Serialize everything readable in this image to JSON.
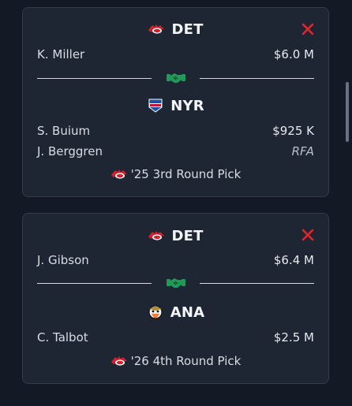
{
  "trades": [
    {
      "teams": [
        {
          "abbr": "DET",
          "players": [
            {
              "name": "K. Miller",
              "value": "$6.0 M"
            }
          ]
        },
        {
          "abbr": "NYR",
          "players": [
            {
              "name": "S. Buium",
              "value": "$925 K"
            },
            {
              "name": "J. Berggren",
              "value": "RFA"
            }
          ],
          "pick": "'25 3rd Round Pick"
        }
      ]
    },
    {
      "teams": [
        {
          "abbr": "DET",
          "players": [
            {
              "name": "J. Gibson",
              "value": "$6.4 M"
            }
          ]
        },
        {
          "abbr": "ANA",
          "players": [
            {
              "name": "C. Talbot",
              "value": "$2.5 M"
            }
          ],
          "pick": "'26 4th Round Pick"
        }
      ]
    }
  ],
  "icons": {
    "remove": "close-icon",
    "trade": "handshake-icon",
    "det_logo": "red-wings-logo-icon",
    "nyr_logo": "rangers-logo-icon",
    "ana_logo": "ducks-logo-icon"
  },
  "colors": {
    "background": "#141a25",
    "card": "#1f2633",
    "remove_red": "#e0262b",
    "handshake_green": "#1f9b57",
    "red_wings": "#d21f2b"
  }
}
